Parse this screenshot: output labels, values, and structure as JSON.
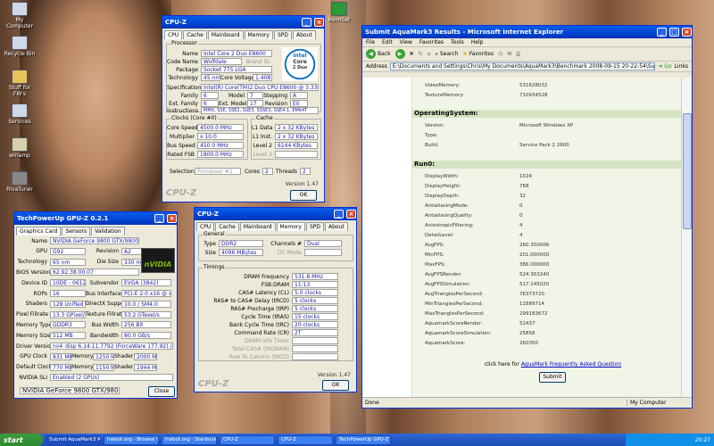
{
  "desktop": {
    "icons": [
      {
        "label": "My Computer"
      },
      {
        "label": "Recycle Bin"
      },
      {
        "label": "Stuff for FW's"
      },
      {
        "label": "Services"
      },
      {
        "label": "winamp"
      },
      {
        "label": "RivaTuner"
      },
      {
        "label": "MemSet"
      }
    ]
  },
  "cpuz": {
    "title": "CPU-Z",
    "tabs": [
      "CPU",
      "Cache",
      "Mainboard",
      "Memory",
      "SPD",
      "About"
    ],
    "processor": {
      "group": "Processor",
      "name_label": "Name",
      "name": "Intel Core 2 Duo E8600",
      "codename_label": "Code Name",
      "codename": "Wolfdale",
      "brandid_label": "Brand ID",
      "package_label": "Package",
      "package": "Socket 775 LGA",
      "tech_label": "Technology",
      "tech": "45 nm",
      "voltage_label": "Core Voltage",
      "voltage": "1.408 V",
      "spec_label": "Specification",
      "spec": "Intel(R) Core(TM)2 Duo CPU  E8600 @ 3.33GHz",
      "family_label": "Family",
      "family": "6",
      "model_label": "Model",
      "model": "7",
      "stepping_label": "Stepping",
      "stepping": "A",
      "extfam_label": "Ext. Family",
      "extfam": "6",
      "extmod_label": "Ext. Model",
      "extmod": "17",
      "rev_label": "Revision",
      "rev": "E0",
      "instr_label": "Instructions",
      "instr": "MMX, SSE, SSE2, SSE3, SSSE3, SSE4.1, EM64T"
    },
    "logo": {
      "brand": "intel",
      "line1": "Core",
      "line2": "2 Duo",
      "line3": "inside"
    },
    "clocks": {
      "group": "Clocks (Core #0)",
      "speed_label": "Core Speed",
      "speed": "4500.0 MHz",
      "mult_label": "Multiplier",
      "mult": "x 10.0",
      "bus_label": "Bus Speed",
      "bus": "450.0 MHz",
      "fsb_label": "Rated FSB",
      "fsb": "1800.0 MHz"
    },
    "cache": {
      "group": "Cache",
      "l1d_label": "L1 Data",
      "l1d": "2 x 32 KBytes",
      "l1i_label": "L1 Inst.",
      "l1i": "2 x 32 KBytes",
      "l2_label": "Level 2",
      "l2": "6144 KBytes",
      "l3_label": "Level 3"
    },
    "selection_label": "Selection",
    "selection": "Processor #1",
    "cores_label": "Cores",
    "cores": "2",
    "threads_label": "Threads",
    "threads": "2",
    "version": "Version 1.47",
    "brand_text": "CPU-Z",
    "ok": "OK"
  },
  "cpuz2": {
    "title": "CPU-Z",
    "tabs": [
      "CPU",
      "Cache",
      "Mainboard",
      "Memory",
      "SPD",
      "About"
    ],
    "general": {
      "group": "General",
      "type_label": "Type",
      "type": "DDR2",
      "channels_label": "Channels #",
      "channels": "Dual",
      "size_label": "Size",
      "size": "4096 MBytes",
      "dc_label": "DC Mode",
      "nb_label": "NB Frequency"
    },
    "timings": {
      "group": "Timings",
      "rows": [
        {
          "label": "DRAM Frequency",
          "value": "531.8 MHz"
        },
        {
          "label": "FSB:DRAM",
          "value": "11:13"
        },
        {
          "label": "CAS# Latency (CL)",
          "value": "5.0 clocks"
        },
        {
          "label": "RAS# to CAS# Delay (tRCD)",
          "value": "5 clocks"
        },
        {
          "label": "RAS# Precharge (tRP)",
          "value": "5 clocks"
        },
        {
          "label": "Cycle Time (tRAS)",
          "value": "15 clocks"
        },
        {
          "label": "Bank Cycle Time (tRC)",
          "value": "20 clocks"
        },
        {
          "label": "Command Rate (CR)",
          "value": "2T"
        },
        {
          "label": "DRAM Idle Timer",
          "value": ""
        },
        {
          "label": "Total CAS# (tRDRAM)",
          "value": ""
        },
        {
          "label": "Row To Column (tRCD)",
          "value": ""
        }
      ]
    },
    "version": "Version 1.47",
    "brand_text": "CPU-Z",
    "ok": "OK"
  },
  "gpuz": {
    "title": "TechPowerUp GPU-Z 0.2.1",
    "tabs": [
      "Graphics Card",
      "Sensors",
      "Validation"
    ],
    "rows": [
      {
        "label": "Name",
        "value": "NVIDIA GeForce 9800 GTX/9800 GTX+"
      },
      {
        "label": "GPU",
        "value": "G92",
        "label2": "Revision",
        "value2": "A2"
      },
      {
        "label": "Technology",
        "value": "65 nm",
        "label2": "Die Size",
        "value2": "330 mm²"
      },
      {
        "label": "BIOS Version",
        "value": "62.92.38.00.07"
      },
      {
        "label": "Device ID",
        "value": "10DE - 0612",
        "label2": "Subvendor",
        "value2": "EVGA (3842)"
      },
      {
        "label": "ROPs",
        "value": "16",
        "label2": "Bus Interface",
        "value2": "PCI-E 2.0 x16 @ x16 2.0"
      },
      {
        "label": "Shaders",
        "value": "128 Unified",
        "label2": "DirectX Support",
        "value2": "10.0 / SM4.0"
      },
      {
        "label": "Pixel Fillrate",
        "value": "13.3 GPixel/s",
        "label2": "Texture Fillrate",
        "value2": "53.2 GTexel/s"
      },
      {
        "label": "Memory Type",
        "value": "GDDR3",
        "label2": "Bus Width",
        "value2": "256 Bit"
      },
      {
        "label": "Memory Size",
        "value": "512 MB",
        "label2": "Bandwidth",
        "value2": "80.0 GB/s"
      },
      {
        "label": "Driver Version",
        "value": "nv4_disp 6.14.11.7792 (ForceWare 177.92) / XP"
      },
      {
        "label": "GPU Clock",
        "value": "831 MHz",
        "label2": "Memory",
        "value2": "1250 MHz",
        "label3": "Shader",
        "value3": "2000 MHz"
      },
      {
        "label": "Default Clock",
        "value": "770 MHz",
        "label2": "Memory",
        "value2": "1150 MHz",
        "label3": "Shader",
        "value3": "1944 MHz"
      },
      {
        "label": "NVIDIA SLI",
        "value": "Enabled (2 GPUs)"
      }
    ],
    "logo": "nVIDIA",
    "select": "NVIDIA GeForce 9800 GTX/9800 GTX+",
    "close": "Close"
  },
  "ie": {
    "title": "Submit AquaMark3 Results - Microsoft Internet Explorer",
    "menu": [
      "File",
      "Edit",
      "View",
      "Favorites",
      "Tools",
      "Help"
    ],
    "back": "Back",
    "search": "Search",
    "favorites": "Favorites",
    "address_label": "Address",
    "address": "E:\\Documents and Settings\\Chris\\My Documents\\AquaMark3\\Benchmark 2008-09-15 20-22-54\\SubmitResults.html",
    "go": "Go",
    "links": "Links",
    "top_rows": [
      {
        "k": "VideoMemory:",
        "v": "531628032"
      },
      {
        "k": "TextureMemory:",
        "v": "710934528"
      }
    ],
    "os_title": "OperatingSystem:",
    "os_rows": [
      {
        "k": "Version:",
        "v": "Microsoft Windows XP"
      },
      {
        "k": "Type:",
        "v": ""
      },
      {
        "k": "Build:",
        "v": "Service Pack 2 2600"
      }
    ],
    "run_title": "Run0:",
    "run_rows": [
      {
        "k": "DisplayWidth:",
        "v": "1024"
      },
      {
        "k": "DisplayHeight:",
        "v": "768"
      },
      {
        "k": "DisplayDepth:",
        "v": "32"
      },
      {
        "k": "AntialiasingMode:",
        "v": "0"
      },
      {
        "k": "AntialiasingQuality:",
        "v": "0"
      },
      {
        "k": "AnisotropicFiltering:",
        "v": "4"
      },
      {
        "k": "DetailLevel:",
        "v": "4"
      },
      {
        "k": "AvgFPS:",
        "v": "260.350006"
      },
      {
        "k": "MinFPS:",
        "v": "201.000000"
      },
      {
        "k": "MaxFPS:",
        "v": "386.000000"
      },
      {
        "k": "AvgFPSRender:",
        "v": "524.363240"
      },
      {
        "k": "AvgFPSSimulation:",
        "v": "517.145020"
      },
      {
        "k": "AvgTrianglesPerSecond:",
        "v": "76373720"
      },
      {
        "k": "MinTrianglesPerSecond:",
        "v": "11889714"
      },
      {
        "k": "MaxTrianglesPerSecond:",
        "v": "299183672"
      },
      {
        "k": "AquamarkScoreRender:",
        "v": "52437"
      },
      {
        "k": "AquamarkScoreSimulation:",
        "v": "25858"
      },
      {
        "k": "AquamarkScore:",
        "v": "260350"
      }
    ],
    "faq_prefix": "click here for",
    "faq_link": "AquaMark Frequently Asked Question",
    "submit": "Submit",
    "status_done": "Done",
    "status_zone": "My Computer"
  },
  "taskbar": {
    "start": "start",
    "tasks": [
      "Submit AquaMark3 R...",
      "hwbot.org - Browse V...",
      "hwbot.org - Starbuck...",
      "CPU-Z",
      "CPU-Z",
      "TechPowerUp GPU-Z ..."
    ],
    "clock": "20:27"
  }
}
